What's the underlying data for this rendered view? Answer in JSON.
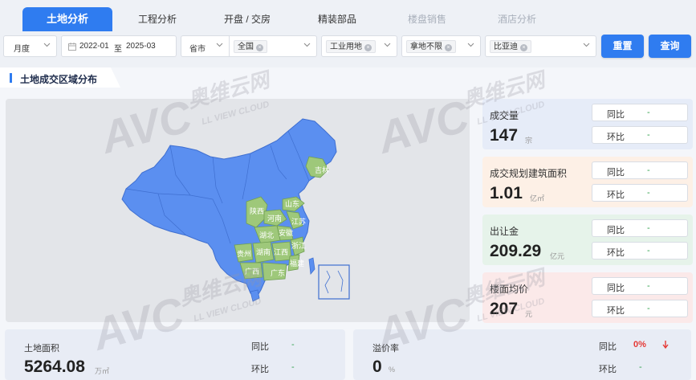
{
  "tabs": [
    {
      "label": "土地分析",
      "active": true
    },
    {
      "label": "工程分析"
    },
    {
      "label": "开盘 / 交房"
    },
    {
      "label": "精装部品"
    },
    {
      "label": "楼盘销售",
      "disabled": true
    },
    {
      "label": "酒店分析",
      "disabled": true
    }
  ],
  "filters": {
    "period": "月度",
    "date_start": "2022-01",
    "date_sep": "至",
    "date_end": "2025-03",
    "region_type": "省市",
    "region_tag": "全国",
    "land_use_tag": "工业用地",
    "acquire_tag": "拿地不限",
    "company_tag": "比亚迪",
    "reset_label": "重置",
    "query_label": "查询"
  },
  "section_title": "土地成交区域分布",
  "watermark": {
    "brand": "AVC",
    "cn": "奥维云网",
    "en": "LL VIEW CLOUD"
  },
  "map": {
    "labels": [
      "吉林",
      "陕西",
      "山东",
      "河南",
      "江苏",
      "安徽",
      "湖北",
      "浙江",
      "贵州",
      "湖南",
      "江西",
      "福建",
      "广西",
      "广东"
    ],
    "base_color": "#5b8ff0",
    "highlight_color": "#9ec87a"
  },
  "stats": [
    {
      "name": "成交量",
      "value": "147",
      "unit": "宗",
      "yoy_label": "同比",
      "yoy": "-",
      "mom_label": "环比",
      "mom": "-",
      "bg": "#e6ecf8"
    },
    {
      "name": "成交规划建筑面积",
      "value": "1.01",
      "unit": "亿㎡",
      "yoy_label": "同比",
      "yoy": "-",
      "mom_label": "环比",
      "mom": "-",
      "bg": "#fdf0e6"
    },
    {
      "name": "出让金",
      "value": "209.29",
      "unit": "亿元",
      "yoy_label": "同比",
      "yoy": "-",
      "mom_label": "环比",
      "mom": "-",
      "bg": "#e6f3ea"
    },
    {
      "name": "楼面均价",
      "value": "207",
      "unit": "元",
      "yoy_label": "同比",
      "yoy": "-",
      "mom_label": "环比",
      "mom": "-",
      "bg": "#fbe9e9"
    }
  ],
  "bottom": [
    {
      "name": "土地面积",
      "value": "5264.08",
      "unit": "万㎡",
      "yoy_label": "同比",
      "yoy": "-",
      "mom_label": "环比",
      "mom": "-"
    },
    {
      "name": "溢价率",
      "value": "0",
      "unit": "%",
      "yoy_label": "同比",
      "yoy": "0%",
      "mom_label": "环比",
      "mom": "-"
    }
  ],
  "colors": {
    "accent": "#2f7cf0",
    "positive": "#2ea04a",
    "negative": "#e53935"
  }
}
